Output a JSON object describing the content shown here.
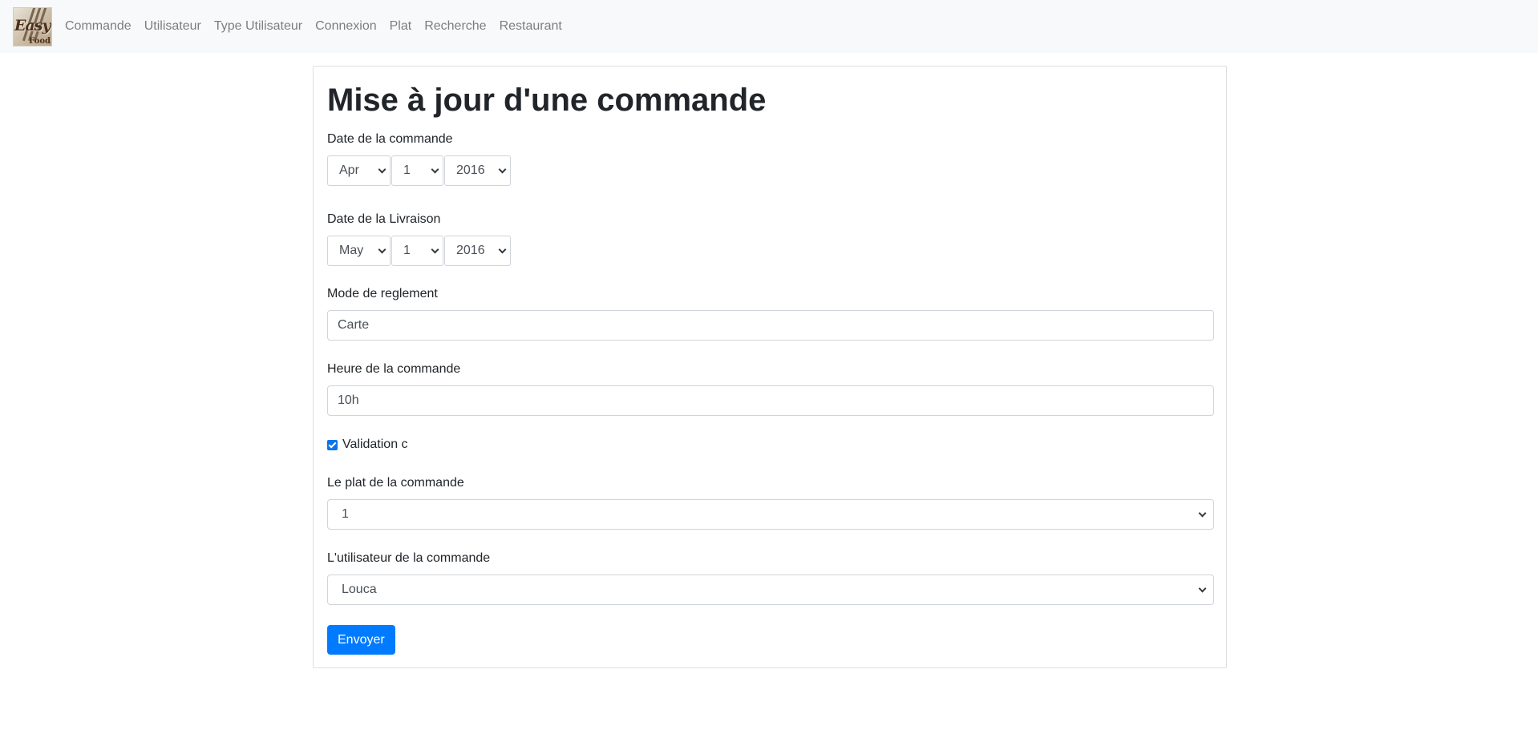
{
  "brand": {
    "logo_text_top": "Easy",
    "logo_text_bottom": "Food"
  },
  "nav": {
    "items": [
      {
        "label": "Commande"
      },
      {
        "label": "Utilisateur"
      },
      {
        "label": "Type Utilisateur"
      },
      {
        "label": "Connexion"
      },
      {
        "label": "Plat"
      },
      {
        "label": "Recherche"
      },
      {
        "label": "Restaurant"
      }
    ]
  },
  "form": {
    "title": "Mise à jour d'une commande",
    "order_date": {
      "label": "Date de la commande",
      "month": "Apr",
      "day": "1",
      "year": "2016"
    },
    "delivery_date": {
      "label": "Date de la Livraison",
      "month": "May",
      "day": "1",
      "year": "2016"
    },
    "payment_mode": {
      "label": "Mode de reglement",
      "value": "Carte"
    },
    "order_time": {
      "label": "Heure de la commande",
      "value": "10h"
    },
    "validation": {
      "label": "Validation c",
      "checked": true
    },
    "dish": {
      "label": "Le plat de la commande",
      "value": "1"
    },
    "user": {
      "label": "L'utilisateur de la commande",
      "value": "Louca"
    },
    "submit_label": "Envoyer"
  },
  "colors": {
    "navbar_bg": "#f8f9fa",
    "primary": "#007bff",
    "checkbox": "#0b74ea"
  }
}
